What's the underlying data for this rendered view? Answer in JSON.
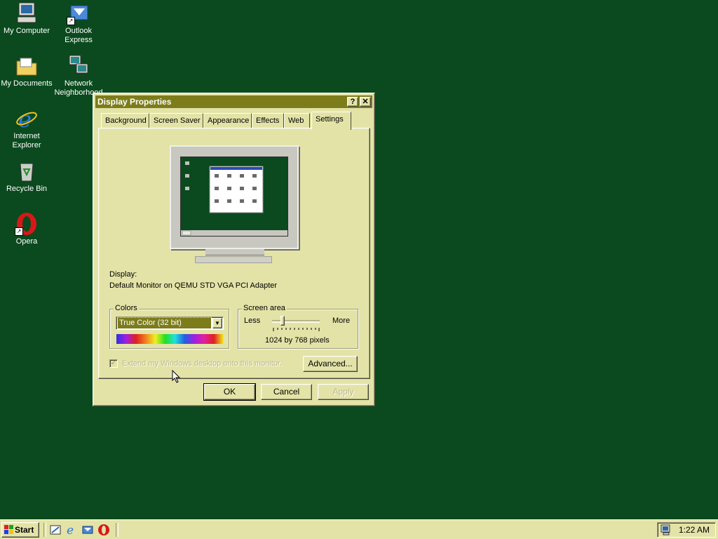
{
  "desktop": {
    "icons": [
      {
        "label": "My Computer"
      },
      {
        "label": "Outlook\nExpress"
      },
      {
        "label": "My Documents"
      },
      {
        "label": "Network\nNeighborhood"
      },
      {
        "label": "Internet\nExplorer"
      },
      {
        "label": "Recycle Bin"
      },
      {
        "label": "Opera"
      }
    ]
  },
  "dialog": {
    "title": "Display Properties",
    "help_btn": "?",
    "close_btn": "✕",
    "tabs": [
      {
        "label": "Background"
      },
      {
        "label": "Screen Saver"
      },
      {
        "label": "Appearance"
      },
      {
        "label": "Effects"
      },
      {
        "label": "Web"
      },
      {
        "label": "Settings"
      }
    ],
    "active_tab": "Settings",
    "display_label": "Display:",
    "display_value": "Default Monitor on QEMU STD VGA PCI Adapter",
    "colors": {
      "group_label": "Colors",
      "selected": "True Color (32 bit)"
    },
    "screen_area": {
      "group_label": "Screen area",
      "less": "Less",
      "more": "More",
      "value_text": "1024 by 768 pixels",
      "slider_level": 0.2
    },
    "extend_checkbox": {
      "label": "Extend my Windows desktop onto this monitor.",
      "checked": true,
      "enabled": false
    },
    "advanced_btn": "Advanced...",
    "ok_btn": "OK",
    "cancel_btn": "Cancel",
    "apply_btn": "Apply"
  },
  "taskbar": {
    "start_label": "Start",
    "clock": "1:22 AM"
  },
  "colors": {
    "desktop": "#0a4a1e",
    "window_face": "#e3e3a8",
    "title_bar": "#7c7c1a"
  }
}
